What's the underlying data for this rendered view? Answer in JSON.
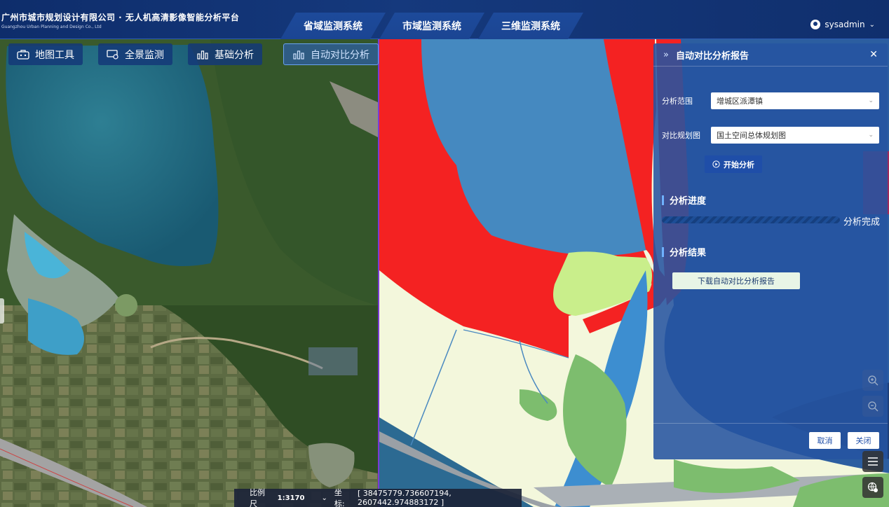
{
  "app": {
    "title": "广州市城市规划设计有限公司 · 无人机高清影像智能分析平台",
    "subtitle": "Guangzhou Urban Planning and Design Co., Ltd"
  },
  "nav": {
    "tabs": [
      {
        "label": "省域监测系统"
      },
      {
        "label": "市域监测系统"
      },
      {
        "label": "三维监测系统"
      }
    ]
  },
  "user": {
    "name": "sysadmin",
    "icon": "user-circle-icon"
  },
  "toolbar": {
    "items": [
      {
        "label": "地图工具",
        "icon": "toolbox-icon"
      },
      {
        "label": "全景监测",
        "icon": "panorama-monitor-icon"
      },
      {
        "label": "基础分析",
        "icon": "bar-chart-icon"
      },
      {
        "label": "自动对比分析",
        "icon": "bar-chart-icon",
        "active": true
      }
    ]
  },
  "panel": {
    "title": "自动对比分析报告",
    "fields": {
      "range_label": "分析范围",
      "range_value": "增城区派潭镇",
      "plan_label": "对比规划图",
      "plan_value": "国土空间总体规划图"
    },
    "start_label": "开始分析",
    "progress_title": "分析进度",
    "progress_value": 100,
    "progress_status": "分析完成",
    "result_title": "分析结果",
    "download_label": "下载自动对比分析报告",
    "cancel_label": "取消",
    "close_label": "关闭"
  },
  "status_bar": {
    "scale_label": "比例尺",
    "scale_value": "1:3170",
    "coord_label": "坐标:",
    "coord_value": "[ 38475779.736607194, 2607442.974883172 ]"
  },
  "colors": {
    "header_bg": "#15397d",
    "panel_bg": "#2654a0",
    "planning_red": "#f42222",
    "water_blue": "#4589c0",
    "farmland": "#f3f7dc",
    "forest_green": "#8ac47a"
  }
}
